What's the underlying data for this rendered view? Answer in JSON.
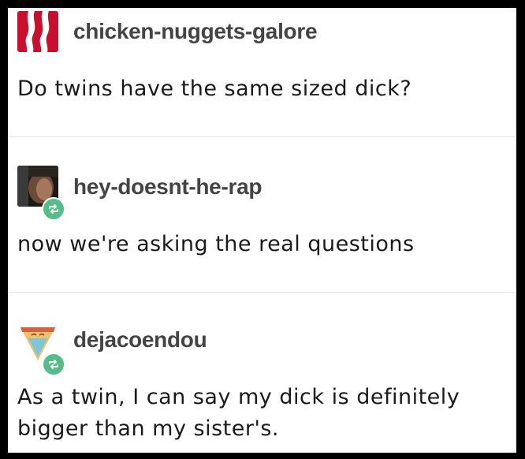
{
  "posts": [
    {
      "username": "chicken-nuggets-galore",
      "avatar": "bacon-avatar-icon",
      "reblogged": false,
      "text": "Do twins have the same sized dick?"
    },
    {
      "username": "hey-doesnt-he-rap",
      "avatar": "photo-avatar",
      "reblogged": true,
      "text": "now we're asking the real questions"
    },
    {
      "username": "dejacoendou",
      "avatar": "pizza-slice-avatar-icon",
      "reblogged": true,
      "text": "As a twin, I can say my dick is definitely bigger than my sister's."
    }
  ],
  "colors": {
    "reblog_badge": "#56bc8a",
    "username": "#444444",
    "bacon_red": "#c8102e"
  }
}
